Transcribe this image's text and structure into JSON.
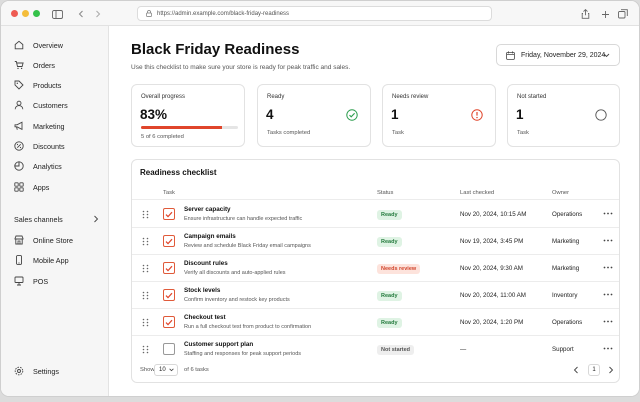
{
  "browser": {
    "url": "https://admin.example.com/black-friday-readiness"
  },
  "sidebar": {
    "items": [
      {
        "label": "Overview",
        "icon": "home-icon"
      },
      {
        "label": "Orders",
        "icon": "cart-icon"
      },
      {
        "label": "Products",
        "icon": "tag-icon"
      },
      {
        "label": "Customers",
        "icon": "person-icon"
      },
      {
        "label": "Marketing",
        "icon": "megaphone-icon"
      },
      {
        "label": "Discounts",
        "icon": "discount-icon"
      },
      {
        "label": "Analytics",
        "icon": "analytics-icon"
      },
      {
        "label": "Apps",
        "icon": "apps-icon"
      }
    ],
    "sales_channels_label": "Sales channels",
    "channels": [
      {
        "label": "Online Store",
        "icon": "store-icon"
      },
      {
        "label": "Mobile App",
        "icon": "phone-icon"
      },
      {
        "label": "POS",
        "icon": "pos-icon"
      }
    ],
    "settings_label": "Settings"
  },
  "header": {
    "title": "Black Friday Readiness",
    "subtitle": "Use this checklist to make sure your store is ready for peak traffic and sales.",
    "date": "Friday, November 29, 2024"
  },
  "cards": {
    "overall": {
      "title": "Overall progress",
      "value": "83%",
      "sub": "5 of 6 completed",
      "progress": 0.83,
      "accent": "#e0452b"
    },
    "ready": {
      "title": "Ready",
      "value": "4",
      "sub": "Tasks completed",
      "color": "#2e9e4f"
    },
    "review": {
      "title": "Needs review",
      "value": "1",
      "sub": "Task",
      "color": "#e0452b"
    },
    "notstarted": {
      "title": "Not started",
      "value": "1",
      "sub": "Task"
    }
  },
  "checklist": {
    "title": "Readiness checklist",
    "columns": {
      "task": "Task",
      "status": "Status",
      "last_checked": "Last checked",
      "owner": "Owner"
    },
    "rows": [
      {
        "name": "Server capacity",
        "desc": "Ensure infrastructure can handle expected traffic",
        "status": "Ready",
        "checked": true,
        "date": "Nov 20, 2024, 10:15 AM",
        "owner": "Operations"
      },
      {
        "name": "Campaign emails",
        "desc": "Review and schedule Black Friday email campaigns",
        "status": "Ready",
        "checked": true,
        "date": "Nov 19, 2024, 3:45 PM",
        "owner": "Marketing"
      },
      {
        "name": "Discount rules",
        "desc": "Verify all discounts and auto-applied rules",
        "status": "Needs review",
        "checked": true,
        "date": "Nov 20, 2024, 9:30 AM",
        "owner": "Marketing"
      },
      {
        "name": "Stock levels",
        "desc": "Confirm inventory and restock key products",
        "status": "Ready",
        "checked": true,
        "date": "Nov 20, 2024, 11:00 AM",
        "owner": "Inventory"
      },
      {
        "name": "Checkout test",
        "desc": "Run a full checkout test from product to confirmation",
        "status": "Ready",
        "checked": true,
        "date": "Nov 20, 2024, 1:20 PM",
        "owner": "Operations"
      },
      {
        "name": "Customer support plan",
        "desc": "Staffing and responses for peak support periods",
        "status": "Not started",
        "checked": false,
        "date": "—",
        "owner": "Support"
      }
    ],
    "footer": {
      "show_label": "Show",
      "page_size": "10",
      "of_label": "of 6 tasks",
      "page": "1"
    }
  }
}
